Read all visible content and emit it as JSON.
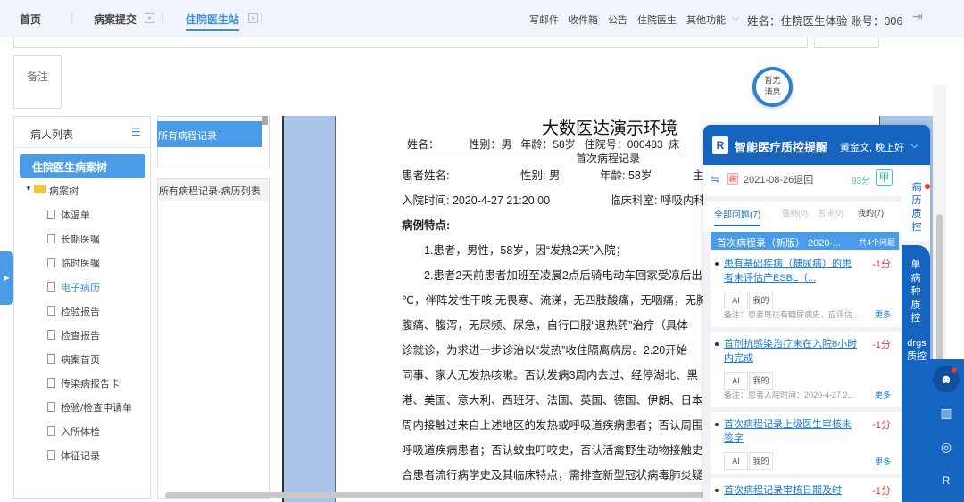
{
  "topbar": {
    "tabs": [
      {
        "label": "首页"
      },
      {
        "label": "病案提交",
        "close": "×"
      },
      {
        "label": "住院医生站",
        "close": "×",
        "active": true
      }
    ],
    "nav": [
      "写邮件",
      "收件箱",
      "公告",
      "住院医生",
      "其他功能"
    ],
    "user": "姓名：住院医生体验 账号：006"
  },
  "remark_label": "备注",
  "notification": "暂无消息",
  "patient_panel": {
    "title": "病人列表",
    "tree_root": "住院医生病案树",
    "folder": "病案树",
    "items": [
      "体温单",
      "长期医嘱",
      "临时医嘱",
      "电子病历",
      "检验报告",
      "检查报告",
      "病案首页",
      "传染病报告卡",
      "检验/检查申请单",
      "入所体检",
      "体征记录"
    ],
    "active_item": "电子病历"
  },
  "records": {
    "selected": "所有病程记录",
    "list_header": "所有病程记录-病历列表"
  },
  "document": {
    "title": "大数医达演示环境",
    "header_line": "姓名：          性别：男   年龄：58岁   住院号：000483  床",
    "subtitle": "首次病程记录",
    "row1": {
      "name": "患者姓名:",
      "sex": "性别: 男",
      "age": "年龄: 58岁",
      "extra": "主"
    },
    "row2": {
      "time": "入院时间: 2020-4-27  21:20:00",
      "dept": "临床科室: 呼吸内科"
    },
    "section": "病例特点:",
    "lines": [
      "1.患者，男性，58岁，因“发热2天”入院；",
      "2.患者2天前患者加班至凌晨2点后骑电动车回家受凉后出",
      "℃，伴阵发性干咳,无畏寒、流涕，无四肢酸痛，无咽痛，无胸",
      "腹痛、腹泻，无尿频、尿急，自行口服“退热药”治疗（具体",
      "诊就诊，为求进一步诊治以“发热”收住隔离病房。2.20开始",
      "同事、家人无发热咳嗽。否认发病3周内去过、经停湖北、黑",
      "港、美国、意大利、西班牙、法国、英国、德国、伊朗、日本、",
      "周内接触过来自上述地区的发热或呼吸道疾病患者；否认周围",
      "呼吸道疾病患者；否认蚊虫叮咬史，否认活禽野生动物接触史",
      "合患者流行病学史及其临床特点，需排查新型冠状病毒肺炎疑"
    ]
  },
  "qc": {
    "title": "智能医疗质控提醒",
    "greeting": "黄金文, 晚上好",
    "badge": "病",
    "date": "2021-08-26退回",
    "score": "93分",
    "grade": "甲",
    "tabs": [
      "全部问题(7)",
      "强制(0)",
      "否决(0)",
      "我的(7)"
    ],
    "group": {
      "title": "首次病程录（新版） 2020-...",
      "count": "共4个问题"
    },
    "issues": [
      {
        "title": "患有基础疾病（糖尿病）的患者未评估产ESBL（...",
        "score": "-1分",
        "tags": [
          "AI",
          "我的"
        ],
        "note": "备注：患者既往有糖尿病史，应评估...",
        "more": "更多"
      },
      {
        "title": "首剂抗感染治疗未在入院8小时内完成",
        "score": "-1分",
        "tags": [
          "AI",
          "我的"
        ],
        "note": "备注：患者入院时间：2020-4-27 2...",
        "more": "更多"
      },
      {
        "title": "首次病程记录上级医生审核未签字",
        "score": "-1分",
        "tags": [
          "AI",
          "我的"
        ],
        "more": "更多"
      },
      {
        "title": "首次病程记录审核日期及时",
        "score": "-1分"
      }
    ],
    "side_tabs": [
      "病历质控",
      "单病种质控",
      "drgs质控"
    ]
  },
  "colors": {
    "primary": "#1565c0",
    "accent": "#4a9be8",
    "danger": "#e53935"
  }
}
